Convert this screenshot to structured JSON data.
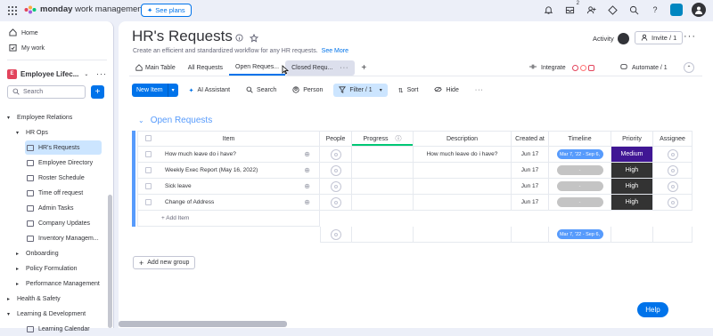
{
  "topbar": {
    "brand_bold": "monday",
    "brand_rest": " work management",
    "see_plans": "See plans",
    "inbox_badge": "2"
  },
  "sidebar": {
    "home": "Home",
    "my_work": "My work",
    "workspace": {
      "initial": "E",
      "name": "Employee Lifec..."
    },
    "search_placeholder": "Search",
    "tree": [
      {
        "label": "Employee Relations",
        "level": 0,
        "caret": "▾"
      },
      {
        "label": "HR Ops",
        "level": 1,
        "caret": "▾"
      },
      {
        "label": "HR's Requests",
        "level": 2,
        "board": true,
        "selected": true
      },
      {
        "label": "Employee Directory",
        "level": 2,
        "board": true
      },
      {
        "label": "Roster Schedule",
        "level": 2,
        "board": true
      },
      {
        "label": "Time off request",
        "level": 2,
        "board": true
      },
      {
        "label": "Admin Tasks",
        "level": 2,
        "board": true
      },
      {
        "label": "Company Updates",
        "level": 2,
        "board": true
      },
      {
        "label": "Inventory Managem...",
        "level": 2,
        "board": true
      },
      {
        "label": "Onboarding",
        "level": 1,
        "caret": "▸"
      },
      {
        "label": "Policy Formulation",
        "level": 1,
        "caret": "▸"
      },
      {
        "label": "Performance Management",
        "level": 1,
        "caret": "▸"
      },
      {
        "label": "Health & Safety",
        "level": 0,
        "caret": "▸"
      },
      {
        "label": "Learning & Development",
        "level": 0,
        "caret": "▾"
      },
      {
        "label": "Learning Calendar",
        "level": 2,
        "board": true
      }
    ]
  },
  "board": {
    "title": "HR's Requests",
    "description": "Create an efficient and standardized workflow for any HR requests.",
    "see_more": "See More",
    "activity": "Activity",
    "invite": "Invite / 1",
    "tabs": [
      "Main Table",
      "All Requests",
      "Open Reques...",
      "Closed Requ..."
    ],
    "integrate": "Integrate",
    "automate": "Automate / 1",
    "toolbar": {
      "new_item": "New Item",
      "ai": "AI Assistant",
      "search": "Search",
      "person": "Person",
      "filter": "Filter / 1",
      "sort": "Sort",
      "hide": "Hide"
    }
  },
  "group": {
    "title": "Open Requests",
    "columns": [
      "Item",
      "People",
      "Progress",
      "Description",
      "Created at",
      "Timeline",
      "Priority",
      "Assignee"
    ],
    "rows": [
      {
        "item": "How much leave do i have?",
        "description": "How much leave do i have?",
        "created": "Jun 17",
        "timeline": "Mar 7, '22 - Sep 6,",
        "priority": "Medium"
      },
      {
        "item": "Weekly Exec Report (May 16, 2022)",
        "description": "",
        "created": "Jun 17",
        "timeline": "-",
        "priority": "High"
      },
      {
        "item": "Sick leave",
        "description": "",
        "created": "Jun 17",
        "timeline": "-",
        "priority": "High"
      },
      {
        "item": "Change of Address",
        "description": "",
        "created": "Jun 17",
        "timeline": "-",
        "priority": "High"
      }
    ],
    "add_item": "+ Add Item",
    "summary_timeline": "Mar 7, '22 - Sep 6,",
    "add_group": "Add new group"
  },
  "help": "Help",
  "colors": {
    "accent": "#0073ea",
    "group": "#579bfc",
    "medium": "#401694",
    "high": "#333333",
    "timeline": "#579bfc",
    "timeline_empty": "#c4c4c4"
  }
}
